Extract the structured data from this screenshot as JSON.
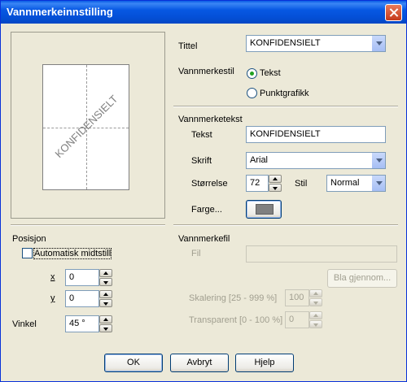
{
  "window": {
    "title": "Vannmerkeinnstilling"
  },
  "preview": {
    "watermark_text": "KONFIDENSIELT"
  },
  "title_field": {
    "label": "Tittel",
    "value": "KONFIDENSIELT"
  },
  "style": {
    "label": "Vannmerkestil",
    "option_text": "Tekst",
    "option_bitmap": "Punktgrafikk",
    "selected": "Tekst"
  },
  "watermark_text": {
    "section_label": "Vannmerketekst",
    "text_label": "Tekst",
    "text_value": "KONFIDENSIELT",
    "font_label": "Skrift",
    "font_value": "Arial",
    "size_label": "Størrelse",
    "size_value": "72",
    "style_label": "Stil",
    "style_value": "Normal",
    "color_label": "Farge...",
    "color": "#808080"
  },
  "position": {
    "section_label": "Posisjon",
    "auto_center_label": "Automatisk midtstill",
    "auto_center_checked": false,
    "x_label": "x",
    "x_value": "0",
    "y_label": "y",
    "y_value": "0",
    "angle_label": "Vinkel",
    "angle_value": "45 °"
  },
  "watermark_file": {
    "section_label": "Vannmerkefil",
    "file_label": "Fil",
    "file_value": "",
    "browse_label": "Bla gjennom...",
    "scale_label": "Skalering [25 - 999 %]",
    "scale_value": "100",
    "transparent_label": "Transparent [0 - 100 %]",
    "transparent_value": "0"
  },
  "buttons": {
    "ok": "OK",
    "cancel": "Avbryt",
    "help": "Hjelp"
  }
}
